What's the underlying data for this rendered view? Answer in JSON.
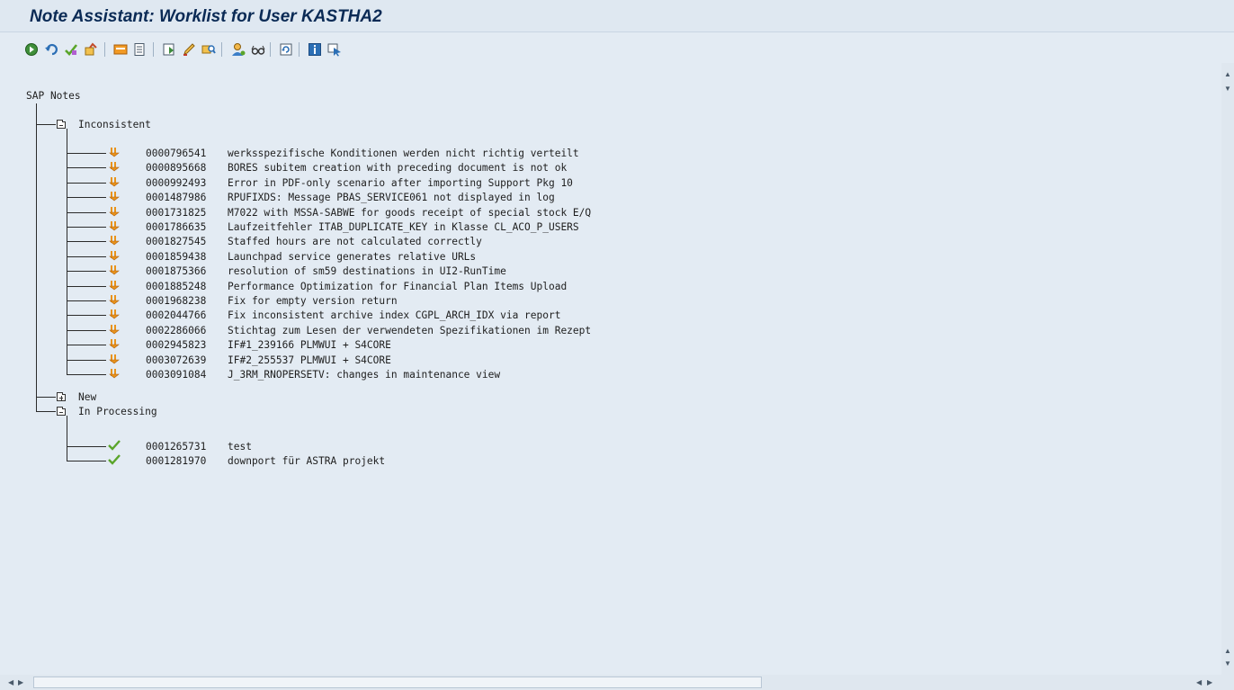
{
  "window": {
    "title": "Note Assistant: Worklist for User KASTHA2"
  },
  "toolbar": {
    "buttons": [
      "execute-icon",
      "undo-icon",
      "check-icon",
      "reset-icon",
      "download-icon",
      "document-icon",
      "import-icon",
      "edit-icon",
      "browse-icon",
      "user-icon",
      "glasses-icon",
      "refresh-icon",
      "info-icon",
      "select-icon"
    ]
  },
  "tree": {
    "root": "SAP Notes",
    "folders": [
      {
        "label": "Inconsistent",
        "expanded": true,
        "status": "inconsistent",
        "items": [
          {
            "number": "0000796541",
            "text": "werksspezifische Konditionen werden nicht richtig verteilt"
          },
          {
            "number": "0000895668",
            "text": "BORES subitem creation with preceding document is not ok"
          },
          {
            "number": "0000992493",
            "text": "Error in PDF-only scenario after importing Support Pkg 10"
          },
          {
            "number": "0001487986",
            "text": "RPUFIXDS: Message PBAS_SERVICE061 not displayed in log"
          },
          {
            "number": "0001731825",
            "text": "M7022 with MSSA-SABWE for goods receipt of special stock E/Q"
          },
          {
            "number": "0001786635",
            "text": "Laufzeitfehler ITAB_DUPLICATE_KEY in Klasse CL_ACO_P_USERS"
          },
          {
            "number": "0001827545",
            "text": "Staffed hours are not calculated correctly"
          },
          {
            "number": "0001859438",
            "text": "Launchpad service generates relative URLs"
          },
          {
            "number": "0001875366",
            "text": "resolution of sm59 destinations in UI2-RunTime"
          },
          {
            "number": "0001885248",
            "text": "Performance Optimization for Financial Plan Items Upload"
          },
          {
            "number": "0001968238",
            "text": "Fix for empty version return"
          },
          {
            "number": "0002044766",
            "text": "Fix inconsistent archive index CGPL_ARCH_IDX via report"
          },
          {
            "number": "0002286066",
            "text": "Stichtag zum Lesen der verwendeten Spezifikationen im Rezept"
          },
          {
            "number": "0002945823",
            "text": "IF#1_239166 PLMWUI + S4CORE"
          },
          {
            "number": "0003072639",
            "text": "IF#2_255537 PLMWUI + S4CORE"
          },
          {
            "number": "0003091084",
            "text": "J_3RM_RNOPERSETV: changes in maintenance view"
          }
        ]
      },
      {
        "label": "New",
        "expanded": false,
        "status": "new",
        "items": []
      },
      {
        "label": "In Processing",
        "expanded": true,
        "status": "done",
        "items": [
          {
            "number": "0001265731",
            "text": "test"
          },
          {
            "number": "0001281970",
            "text": "downport für ASTRA projekt"
          }
        ]
      }
    ]
  },
  "colors": {
    "background": "#e3ebf3",
    "title_text": "#0a2a55",
    "inconsistent_icon": "#e8931c",
    "done_icon": "#5aa52a"
  }
}
